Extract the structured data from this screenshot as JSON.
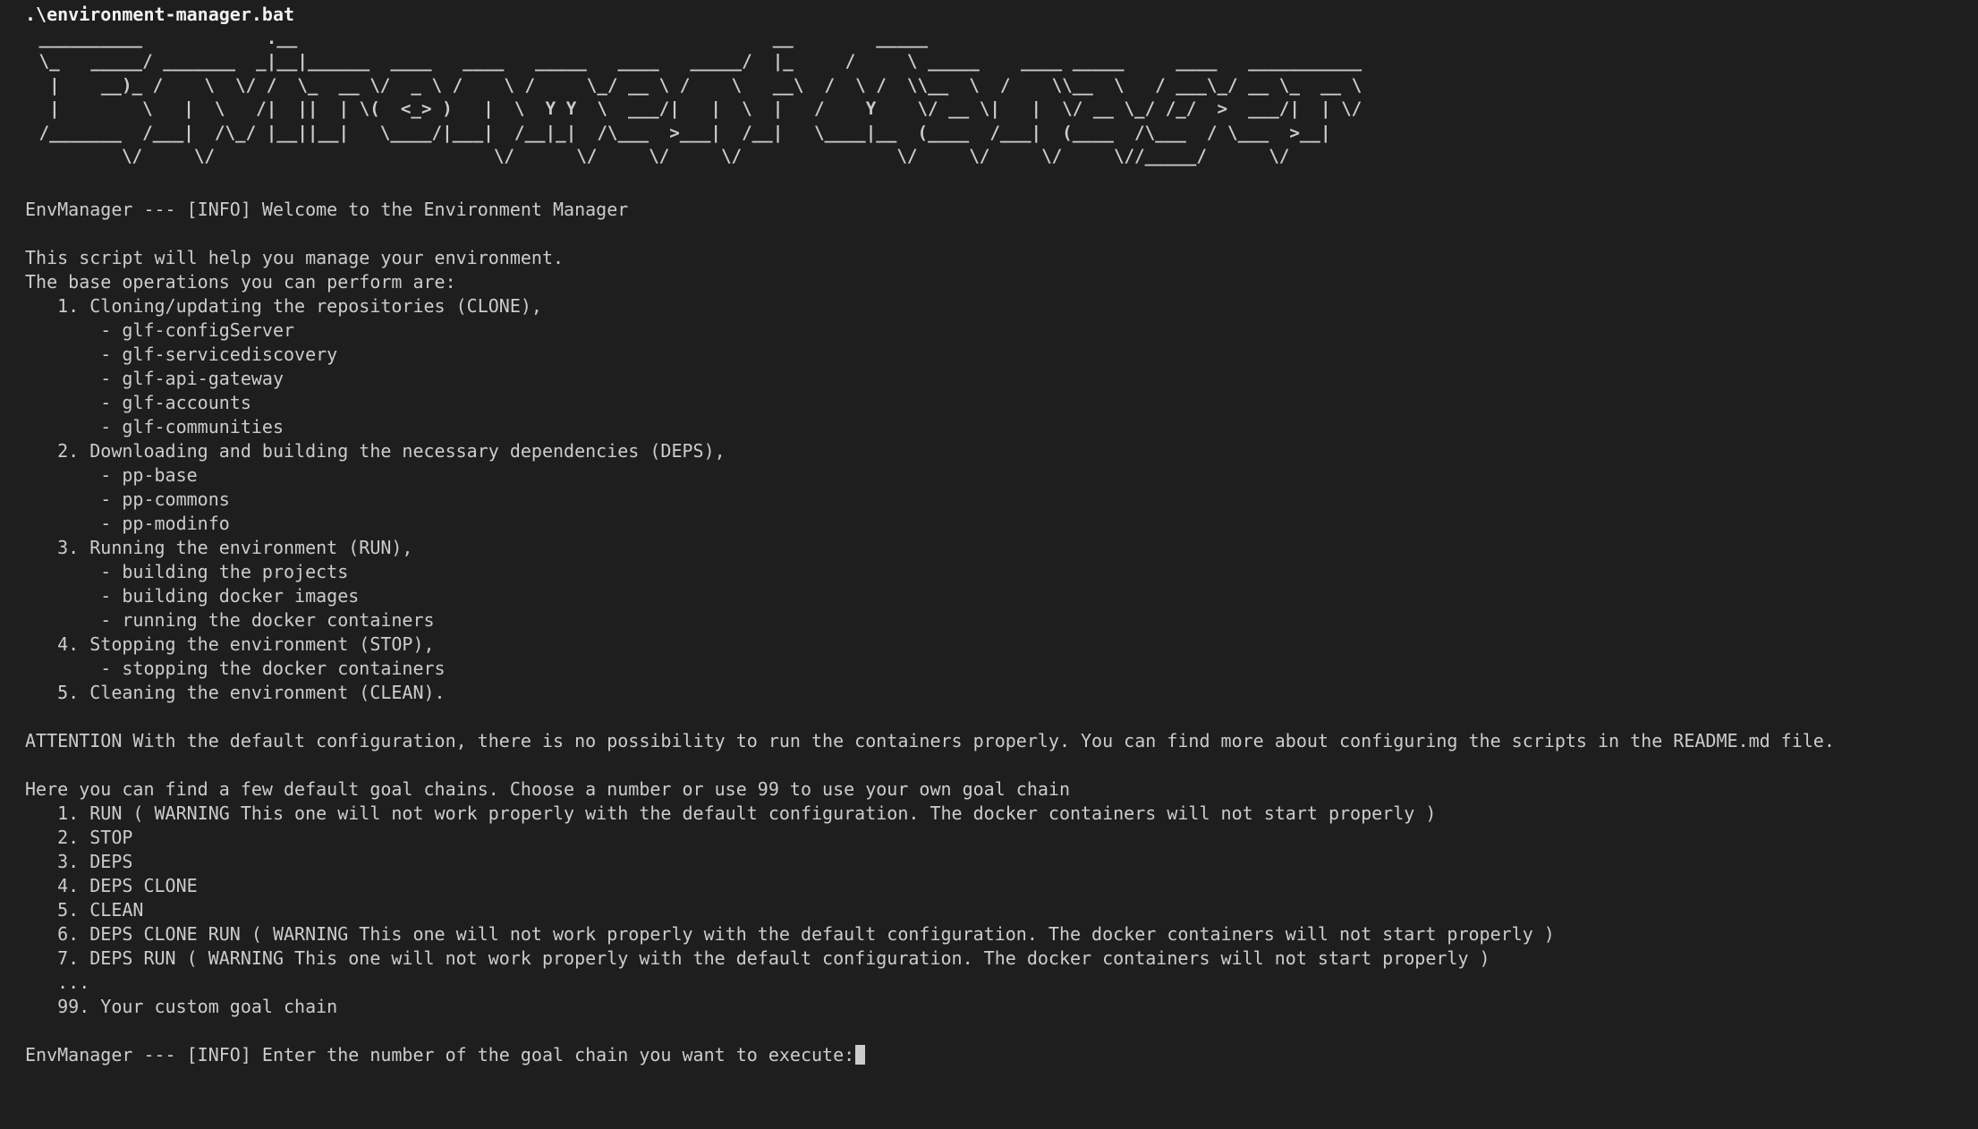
{
  "command": ".\\environment-manager.bat",
  "banner_lines": [
    " __________            .__                                              __        _____",
    " \\_   _____/ _______  _|__|______  ____   ____   _____   ____   _____/  |_     /     \\ _____    ____ _____     ____   ___________",
    "  |    __)_ /    \\  \\/ /  \\_  __ \\/  _ \\ /    \\ /     \\_/ __ \\ /    \\   __\\  /  \\ /  \\\\__  \\  /    \\\\__  \\   / ___\\_/ __ \\_  __ \\",
    "  |        \\   |  \\   /|  ||  | \\(  <_> )   |  \\  Y Y  \\  ___/|   |  \\  |   /    Y    \\/ __ \\|   |  \\/ __ \\_/ /_/  >  ___/|  | \\/",
    " /_______  /___|  /\\_/ |__||__|   \\____/|___|  /__|_|  /\\___  >___|  /__|   \\____|__  (____  /___|  (____  /\\___  / \\___  >__|",
    "         \\/     \\/                           \\/      \\/     \\/     \\/               \\/     \\/     \\/     \\//_____/      \\/"
  ],
  "welcome": "EnvManager --- [INFO] Welcome to the Environment Manager",
  "intro": "This script will help you manage your environment.",
  "ops_heading": "The base operations you can perform are:",
  "operations": [
    "   1. Cloning/updating the repositories (CLONE),",
    "       - glf-configServer",
    "       - glf-servicediscovery",
    "       - glf-api-gateway",
    "       - glf-accounts",
    "       - glf-communities",
    "   2. Downloading and building the necessary dependencies (DEPS),",
    "       - pp-base",
    "       - pp-commons",
    "       - pp-modinfo",
    "   3. Running the environment (RUN),",
    "       - building the projects",
    "       - building docker images",
    "       - running the docker containers",
    "   4. Stopping the environment (STOP),",
    "       - stopping the docker containers",
    "   5. Cleaning the environment (CLEAN)."
  ],
  "attention": "ATTENTION With the default configuration, there is no possibility to run the containers properly. You can find more about configuring the scripts in the README.md file.",
  "chains_heading": "Here you can find a few default goal chains. Choose a number or use 99 to use your own goal chain",
  "chains": [
    "   1. RUN ( WARNING This one will not work properly with the default configuration. The docker containers will not start properly )",
    "   2. STOP",
    "   3. DEPS",
    "   4. DEPS CLONE",
    "   5. CLEAN",
    "   6. DEPS CLONE RUN ( WARNING This one will not work properly with the default configuration. The docker containers will not start properly )",
    "   7. DEPS RUN ( WARNING This one will not work properly with the default configuration. The docker containers will not start properly )",
    "   ...",
    "   99. Your custom goal chain"
  ],
  "prompt": "EnvManager --- [INFO] Enter the number of the goal chain you want to execute:",
  "colors": {
    "background": "#1e1e1e",
    "text": "#cccccc",
    "command": "#f2f2f2"
  }
}
